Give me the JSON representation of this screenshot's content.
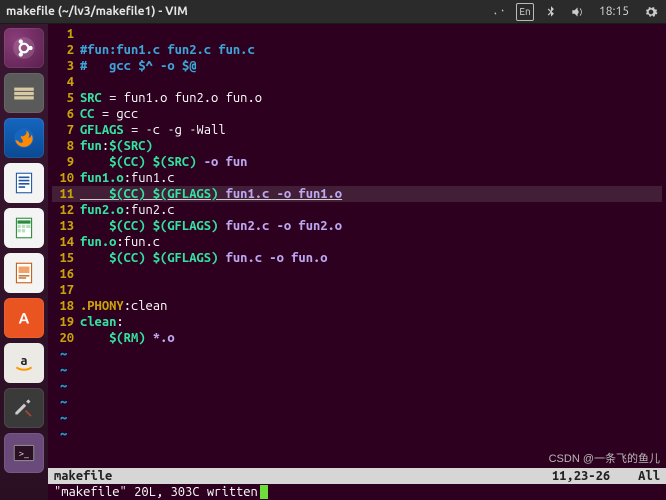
{
  "menubar": {
    "title": "makefile (~/lv3/makefile1) - VIM",
    "lang": "En",
    "time": "18:15"
  },
  "launcher": {
    "items": [
      {
        "name": "ubuntu-dash-icon"
      },
      {
        "name": "files-icon"
      },
      {
        "name": "firefox-icon"
      },
      {
        "name": "writer-icon"
      },
      {
        "name": "calc-icon"
      },
      {
        "name": "impress-icon"
      },
      {
        "name": "software-icon"
      },
      {
        "name": "amazon-icon"
      },
      {
        "name": "settings-icon"
      },
      {
        "name": "terminal-icon"
      }
    ]
  },
  "code": {
    "lines": [
      {
        "n": "1",
        "segs": []
      },
      {
        "n": "2",
        "segs": [
          {
            "c": "c-comment",
            "t": "#fun:fun1.c fun2.c fun.c"
          }
        ]
      },
      {
        "n": "3",
        "segs": [
          {
            "c": "c-comment",
            "t": "#   gcc $^ -o $@"
          }
        ]
      },
      {
        "n": "4",
        "segs": []
      },
      {
        "n": "5",
        "segs": [
          {
            "c": "c-ident",
            "t": "SRC"
          },
          {
            "c": "c-op",
            "t": " = fun1.o fun2.o fun.o"
          }
        ]
      },
      {
        "n": "6",
        "segs": [
          {
            "c": "c-ident",
            "t": "CC"
          },
          {
            "c": "c-op",
            "t": " = gcc"
          }
        ]
      },
      {
        "n": "7",
        "segs": [
          {
            "c": "c-ident",
            "t": "GFLAGS"
          },
          {
            "c": "c-op",
            "t": " = -c -g -Wall"
          }
        ]
      },
      {
        "n": "8",
        "segs": [
          {
            "c": "c-ident",
            "t": "fun"
          },
          {
            "c": "c-op",
            "t": ":"
          },
          {
            "c": "c-var",
            "t": "$(SRC)"
          }
        ]
      },
      {
        "n": "9",
        "segs": [
          {
            "c": "c-plain",
            "t": "    "
          },
          {
            "c": "c-var",
            "t": "$(CC) $(SRC)"
          },
          {
            "c": "c-str",
            "t": " -o fun"
          }
        ]
      },
      {
        "n": "10",
        "segs": [
          {
            "c": "c-ident",
            "t": "fun1.o"
          },
          {
            "c": "c-op",
            "t": ":fun1.c"
          }
        ]
      },
      {
        "n": "11",
        "segs": [
          {
            "c": "c-plain",
            "t": "    "
          },
          {
            "c": "c-var",
            "t": "$(CC) $(GFLAGS)"
          },
          {
            "c": "c-str",
            "t": " fun1.c -o fun1.o"
          }
        ],
        "current": true
      },
      {
        "n": "12",
        "segs": [
          {
            "c": "c-ident",
            "t": "fun2.o"
          },
          {
            "c": "c-op",
            "t": ":fun2.c"
          }
        ]
      },
      {
        "n": "13",
        "segs": [
          {
            "c": "c-plain",
            "t": "    "
          },
          {
            "c": "c-var",
            "t": "$(CC) $(GFLAGS)"
          },
          {
            "c": "c-str",
            "t": " fun2.c -o fun2.o"
          }
        ]
      },
      {
        "n": "14",
        "segs": [
          {
            "c": "c-ident",
            "t": "fun.o"
          },
          {
            "c": "c-op",
            "t": ":fun.c"
          }
        ]
      },
      {
        "n": "15",
        "segs": [
          {
            "c": "c-plain",
            "t": "    "
          },
          {
            "c": "c-var",
            "t": "$(CC) $(GFLAGS)"
          },
          {
            "c": "c-str",
            "t": " fun.c -o fun.o"
          }
        ]
      },
      {
        "n": "16",
        "segs": []
      },
      {
        "n": "17",
        "segs": []
      },
      {
        "n": "18",
        "segs": [
          {
            "c": "c-key",
            "t": ".PHONY"
          },
          {
            "c": "c-op",
            "t": ":"
          },
          {
            "c": "c-plain",
            "t": "clean"
          }
        ]
      },
      {
        "n": "19",
        "segs": [
          {
            "c": "c-ident",
            "t": "clean"
          },
          {
            "c": "c-op",
            "t": ":"
          }
        ]
      },
      {
        "n": "20",
        "segs": [
          {
            "c": "c-plain",
            "t": "    "
          },
          {
            "c": "c-var",
            "t": "$(RM)"
          },
          {
            "c": "c-str",
            "t": " *.o"
          }
        ]
      }
    ],
    "tilde_rows": 6
  },
  "status": {
    "filename": "makefile",
    "position": "11,23-26",
    "scroll": "All",
    "message": "\"makefile\" 20L, 303C written"
  },
  "watermark": "CSDN @一条飞的鱼儿"
}
